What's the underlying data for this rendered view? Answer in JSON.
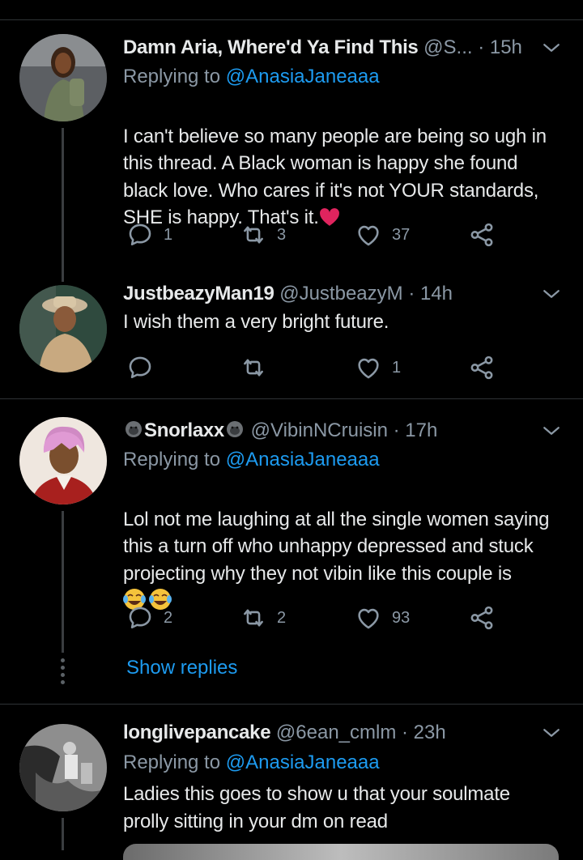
{
  "tweets": [
    {
      "name": "Damn Aria, Where'd Ya Find This",
      "handle": "@S...",
      "time": "· 15h",
      "replying_prefix": "Replying to ",
      "replying_to": "@AnasiaJaneaaa",
      "text": "I can't believe so many people are being so ugh in this thread. A Black woman is happy she found black love. Who cares if it's not YOUR standards, SHE is happy. That's it.",
      "emoji": "red-heart-emoji",
      "replies": "1",
      "retweets": "3",
      "likes": "37"
    },
    {
      "name": "JustbeazyMan19",
      "handle": "@JustbeazyM",
      "time": "· 14h",
      "text": "I wish them a very bright future.",
      "replies": "",
      "retweets": "",
      "likes": "1"
    },
    {
      "name": "Snorlaxx",
      "handle": "@VibinNCruisin",
      "time": "· 17h",
      "replying_prefix": "Replying to ",
      "replying_to": "@AnasiaJaneaaa",
      "text": "Lol not me laughing at all the single women saying this a turn off who unhappy depressed and stuck projecting why they not vibin like this couple is ",
      "emoji": "tears-of-joy-emoji",
      "replies": "2",
      "retweets": "2",
      "likes": "93",
      "show_replies": "Show replies"
    },
    {
      "name": "longlivepancake",
      "handle": "@6ean_cmlm",
      "time": "· 23h",
      "replying_prefix": "Replying to ",
      "replying_to": "@AnasiaJaneaaa",
      "text": "Ladies this goes to show u that your soulmate prolly sitting in your dm on read"
    }
  ],
  "colors": {
    "background": "#000000",
    "text": "#e7e9ea",
    "secondary": "#8b98a5",
    "link": "#1d9bf0",
    "divider": "#2f3336"
  },
  "icons": [
    "reply-icon",
    "retweet-icon",
    "like-icon",
    "share-icon",
    "chevron-down-icon",
    "gorilla-emoji"
  ]
}
